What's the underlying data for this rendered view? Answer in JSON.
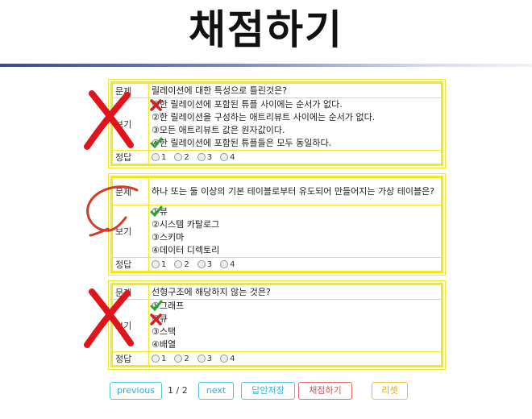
{
  "header": {
    "title": "채점하기"
  },
  "labels": {
    "question": "문제",
    "choices": "보기",
    "answer": "정답"
  },
  "answer_options": [
    "1",
    "2",
    "3",
    "4"
  ],
  "questions": [
    {
      "text": "릴레이션에 대한 특성으로 틀린것은?",
      "result": "incorrect",
      "options": [
        "①한 릴레이션에 포함된 튜플 사이에는 순서가 없다.",
        "②한 릴레이션을 구성하는 애트리뷰트 사이에는 순서가 없다.",
        "③모든 애트리뷰트 값은 원자값이다.",
        "④한 릴레이션에 포함된 튜플들은 모두 동일하다."
      ],
      "option_marks": [
        "x",
        "",
        "",
        "check"
      ]
    },
    {
      "text": "하나 또는 둘 이상의 기본 테이블로부터 유도되어 만들어지는 가상 테이블은?",
      "result": "correct",
      "options": [
        "①뷰",
        "②시스템 카탈로그",
        "③스키마",
        "④데이터 디렉토리"
      ],
      "option_marks": [
        "check",
        "",
        "",
        ""
      ]
    },
    {
      "text": "선형구조에 해당하지 않는 것은?",
      "result": "incorrect",
      "options": [
        "①그래프",
        "②큐",
        "③스택",
        "④배열"
      ],
      "option_marks": [
        "check",
        "x",
        "",
        ""
      ]
    }
  ],
  "pagination": {
    "previous": "previous",
    "page_info": "1 / 2",
    "next": "next"
  },
  "actions": {
    "save": "답안저장",
    "grade": "채점하기",
    "reset": "리셋"
  },
  "colors": {
    "border": "#f2ea20",
    "check": "#2aa52a",
    "x": "#e01a1a",
    "circle": "#d23a2a"
  }
}
